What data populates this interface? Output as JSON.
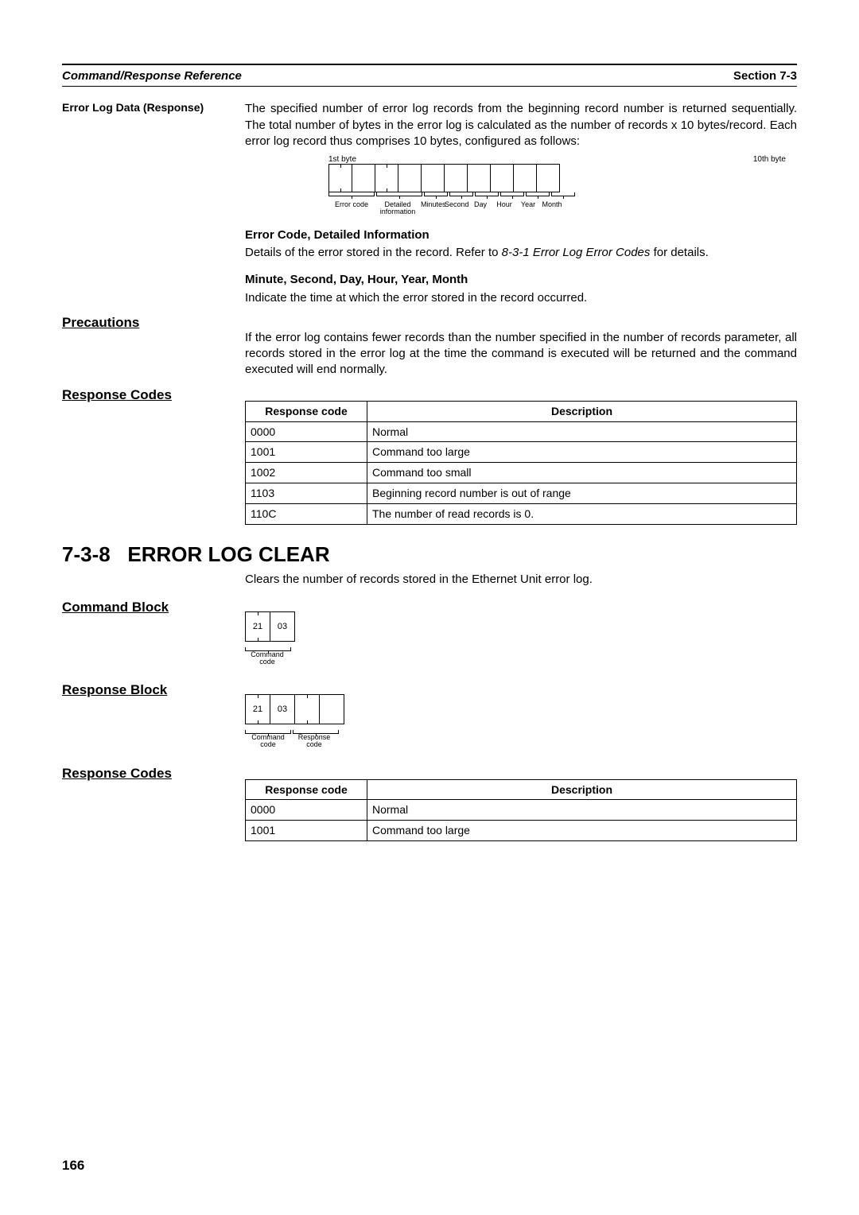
{
  "header": {
    "left": "Command/Response Reference",
    "right": "Section 7-3"
  },
  "error_log_data": {
    "sidebar": "Error Log Data (Response)",
    "paragraph": "The specified number of error log records from the beginning record number is returned sequentially. The total number of bytes in the error log is calculated as the number of records x 10 bytes/record. Each error log record thus comprises 10 bytes, configured as follows:",
    "byte_left": "1st byte",
    "byte_right": "10th byte",
    "labels": {
      "error_code": "Error code",
      "detailed": "Detailed\ninformation",
      "minutes": "Minutes",
      "second": "Second",
      "day": "Day",
      "hour": "Hour",
      "year": "Year",
      "month": "Month"
    },
    "sub1_head": "Error Code, Detailed Information",
    "sub1_text_pre": "Details of the error stored in the record. Refer to ",
    "sub1_text_ref": "8-3-1 Error Log Error Codes",
    "sub1_text_post": " for details.",
    "sub2_head": "Minute, Second, Day, Hour, Year, Month",
    "sub2_text": "Indicate the time at which the error stored in the record occurred."
  },
  "precautions": {
    "sidebar": "Precautions",
    "text": "If the error log contains fewer records than the number specified in the number of records parameter, all records stored in the error log at the time the command is executed will be returned and the command executed will end normally."
  },
  "response_codes1": {
    "sidebar": "Response Codes",
    "thead": {
      "c1": "Response code",
      "c2": "Description"
    },
    "rows": [
      {
        "c1": "0000",
        "c2": "Normal"
      },
      {
        "c1": "1001",
        "c2": "Command too large"
      },
      {
        "c1": "1002",
        "c2": "Command too small"
      },
      {
        "c1": "1103",
        "c2": "Beginning record number is out of range"
      },
      {
        "c1": "110C",
        "c2": "The number of read records is 0."
      }
    ]
  },
  "section738": {
    "number": "7-3-8",
    "title": "ERROR LOG CLEAR",
    "intro": "Clears the number of records stored in the Ethernet Unit error log."
  },
  "command_block": {
    "sidebar": "Command Block",
    "b1": "21",
    "b2": "03",
    "label": "Command code"
  },
  "response_block": {
    "sidebar": "Response Block",
    "b1": "21",
    "b2": "03",
    "label1": "Command\ncode",
    "label2": "Response\ncode"
  },
  "response_codes2": {
    "sidebar": "Response Codes",
    "thead": {
      "c1": "Response code",
      "c2": "Description"
    },
    "rows": [
      {
        "c1": "0000",
        "c2": "Normal"
      },
      {
        "c1": "1001",
        "c2": "Command too large"
      }
    ]
  },
  "page_number": "166"
}
